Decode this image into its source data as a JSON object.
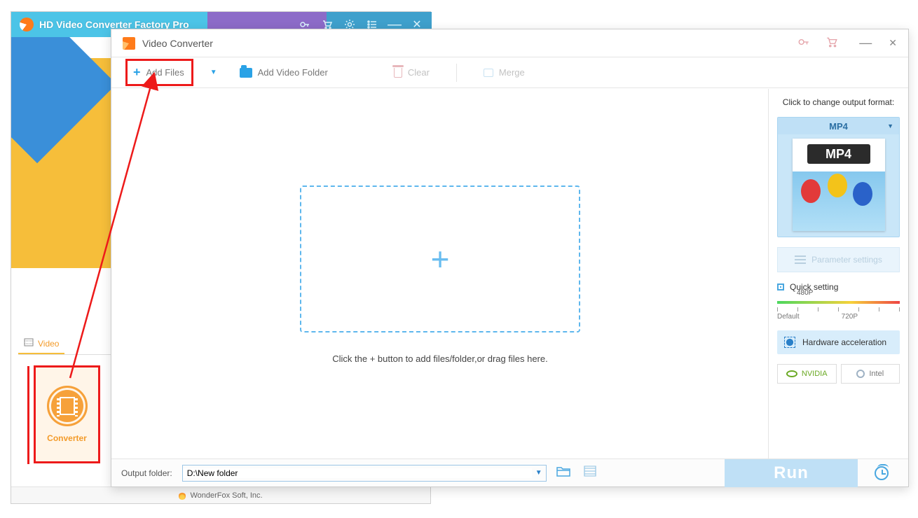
{
  "main_window": {
    "title": "HD Video Converter Factory Pro",
    "tab_video": "Video",
    "converter_label": "Converter",
    "footer": "WonderFox Soft, Inc."
  },
  "conv_window": {
    "title": "Video Converter",
    "toolbar": {
      "add_files": "Add Files",
      "add_folder": "Add Video Folder",
      "clear": "Clear",
      "merge": "Merge"
    },
    "drop_hint": "Click the + button to add files/folder,or drag files here.",
    "right_panel": {
      "change_format_label": "Click to change output format:",
      "format_name": "MP4",
      "format_big": "MP4",
      "param_settings": "Parameter settings",
      "quick_setting": "Quick setting",
      "quality_value": "480P",
      "quality_default": "Default",
      "quality_720p": "720P",
      "hw_accel": "Hardware acceleration",
      "vendor_nvidia": "NVIDIA",
      "vendor_intel": "Intel"
    },
    "bottom": {
      "output_label": "Output folder:",
      "output_value": "D:\\New folder",
      "run": "Run"
    }
  }
}
